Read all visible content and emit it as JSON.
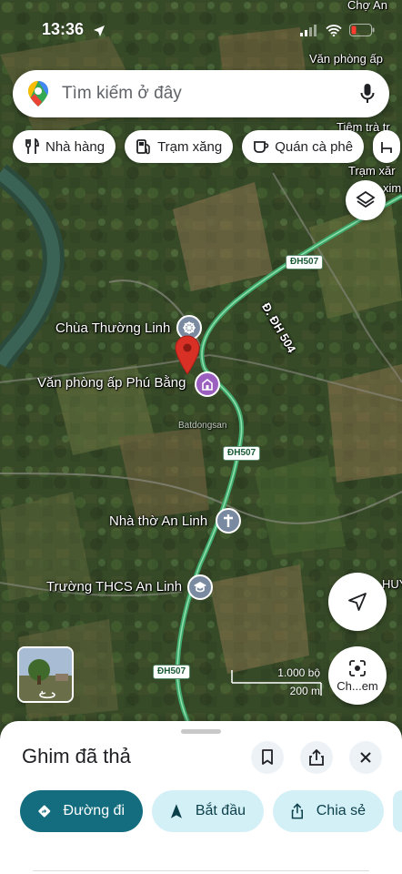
{
  "status": {
    "time": "13:36"
  },
  "search": {
    "placeholder": "Tìm kiếm ở đây"
  },
  "chips": [
    {
      "label": "Nhà hàng",
      "icon": "fork-knife-icon"
    },
    {
      "label": "Trạm xăng",
      "icon": "gas-station-icon"
    },
    {
      "label": "Quán cà phê",
      "icon": "coffee-cup-icon"
    }
  ],
  "map": {
    "places": {
      "chua": "Chùa Thường Linh",
      "vanphong": "Văn phòng ấp Phú Bằng",
      "nhatho": "Nhà thờ An Linh",
      "truong": "Trường THCS An Linh"
    },
    "edge_labels": {
      "top_right": "Chợ An",
      "vanphong_ap": "Văn phòng ấp",
      "tiem_tra": "Tiệm trà tr",
      "tram_xang": "Trạm xăr",
      "xim": "xim",
      "huyen": "HUYÊ"
    },
    "roads": {
      "dh507_a": "ĐH507",
      "dh507_b": "ĐH507",
      "dh507_c": "ĐH507",
      "dh504": "Đ. ĐH 504"
    },
    "watermark": "Batdongsan",
    "scale": {
      "imperial": "1.000 bộ",
      "metric": "200 m"
    },
    "street_view_label": "Ch...em"
  },
  "sheet": {
    "title": "Ghim đã thả",
    "actions": [
      {
        "label": "Đường đi"
      },
      {
        "label": "Bắt đầu"
      },
      {
        "label": "Chia sẻ"
      }
    ]
  },
  "colors": {
    "primary_action": "#136d7e",
    "secondary_action": "#d4f0f7",
    "pin": "#d93025",
    "road": "#3fa86b"
  }
}
